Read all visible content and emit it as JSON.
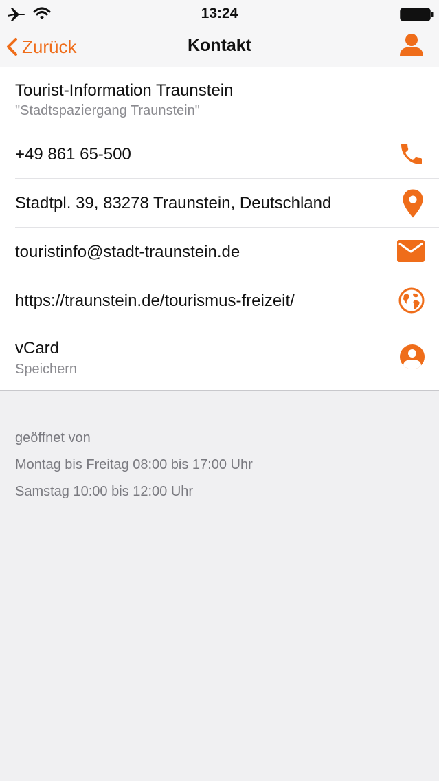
{
  "status_bar": {
    "time": "13:24",
    "icons": [
      "airplane-icon",
      "wifi-icon",
      "battery-icon"
    ]
  },
  "nav": {
    "back_label": "Zurück",
    "title": "Kontakt",
    "right_icon": "person-icon"
  },
  "contact": {
    "name": "Tourist-Information Traunstein",
    "subtitle": "\"Stadtspaziergang Traunstein\"",
    "phone": "+49 861 65-500",
    "address": "Stadtpl. 39, 83278 Traunstein, Deutschland",
    "email": "touristinfo@stadt-traunstein.de",
    "website": "https://traunstein.de/tourismus-freizeit/",
    "vcard_label": "vCard",
    "vcard_action": "Speichern"
  },
  "hours": {
    "heading": "geöffnet von",
    "lines": [
      "Montag bis Freitag 08:00 bis 17:00 Uhr",
      "Samstag 10:00 bis 12:00 Uhr"
    ]
  },
  "colors": {
    "accent": "#ef6d1a",
    "background": "#f0f0f2",
    "card": "#ffffff",
    "secondary_text": "#8a8a8f"
  }
}
